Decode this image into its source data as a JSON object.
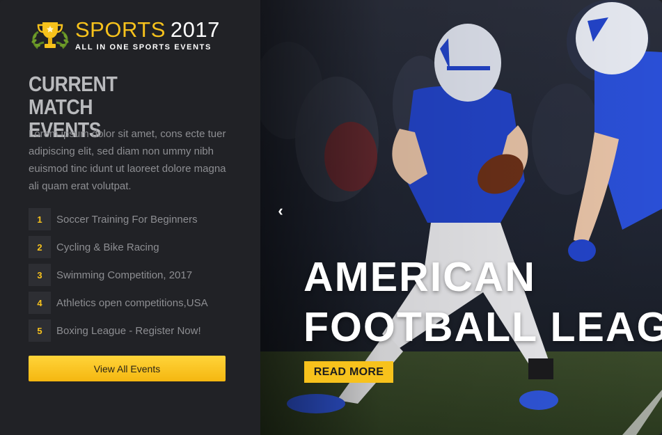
{
  "logo": {
    "title_main": "SPORTS",
    "title_year": "2017",
    "tagline": "ALL IN ONE SPORTS EVENTS"
  },
  "sidebar": {
    "heading_line1": "CURRENT MATCH",
    "heading_line2": "EVENTS",
    "description": "Lorem ipsum dolor sit amet, cons ecte tuer adipiscing elit, sed diam non ummy nibh euismod tinc idunt ut laoreet dolore magna ali quam erat volutpat.",
    "events": [
      {
        "number": "1",
        "label": "Soccer Training For Beginners"
      },
      {
        "number": "2",
        "label": "Cycling & Bike Racing"
      },
      {
        "number": "3",
        "label": "Swimming Competition, 2017"
      },
      {
        "number": "4",
        "label": "Athletics open competitions,USA"
      },
      {
        "number": "5",
        "label": "Boxing League - Register Now!"
      }
    ],
    "view_all_label": "View All Events"
  },
  "hero": {
    "title_line1": "AMERICAN",
    "title_line2": "FOOTBALL LEAG",
    "read_more_label": "READ MORE",
    "prev_icon": "‹"
  },
  "colors": {
    "accent": "#f7c21c",
    "sidebar_bg": "#212226",
    "number_bg": "#2d2e33"
  }
}
